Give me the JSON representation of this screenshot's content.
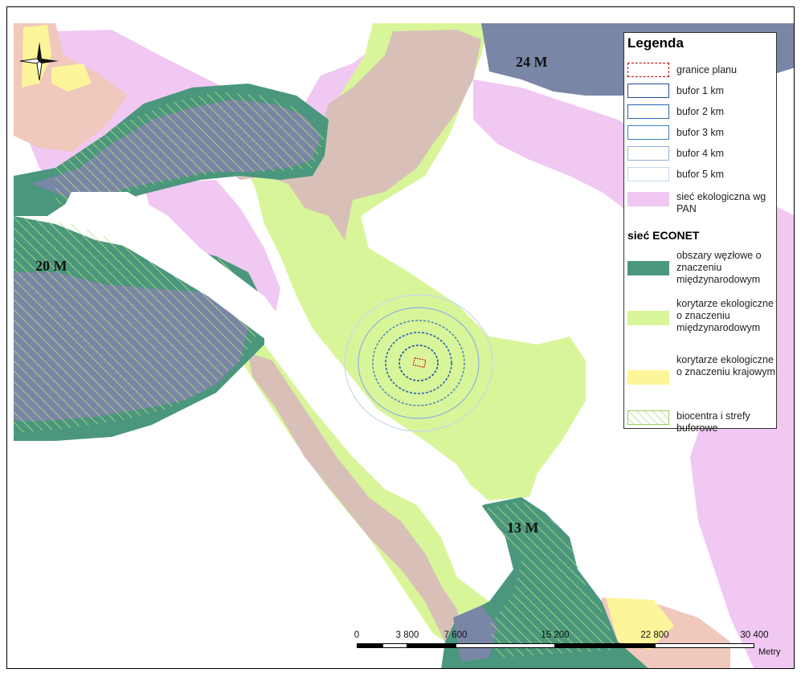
{
  "colors": {
    "node_international": "#4a977d",
    "corridor_international": "#d9f59a",
    "corridor_national": "#fdf59a",
    "pan_network": "#f0c8f2",
    "biocentre_hatch": "#b8e07a",
    "overlap_blue": "#7a86a6",
    "mauve": "#d8c0b8",
    "salmon": "#f0c8bc",
    "plan_border": "#c00000",
    "buffer_1km": "#1f4ea1",
    "buffer_2km": "#2a63b3",
    "buffer_3km": "#3f7ec4",
    "buffer_4km": "#8fb2df",
    "buffer_5km": "#c7d8ec"
  },
  "map": {
    "zone_labels": [
      {
        "text": "24 M"
      },
      {
        "text": "20 M"
      },
      {
        "text": "13 M"
      }
    ],
    "north_arrow_icon": "compass-rose-icon"
  },
  "legend": {
    "title": "Legenda",
    "items": [
      {
        "key": "plan",
        "label": "granice planu"
      },
      {
        "key": "b1",
        "label": "bufor 1 km"
      },
      {
        "key": "b2",
        "label": "bufor 2 km"
      },
      {
        "key": "b3",
        "label": "bufor 3 km"
      },
      {
        "key": "b4",
        "label": "bufor 4 km"
      },
      {
        "key": "b5",
        "label": "bufor 5 km"
      },
      {
        "key": "pan",
        "label": "sieć ekologiczna wg PAN"
      }
    ],
    "econet_title": "sieć ECONET",
    "econet_items": [
      {
        "key": "node",
        "label": "obszary węzłowe o znaczeniu międzynarodowym"
      },
      {
        "key": "corr_int",
        "label": "korytarze ekologiczne o znaczeniu międzynarodowym"
      },
      {
        "key": "corr_nat",
        "label": "korytarze ekologiczne o znaczeniu krajowym"
      },
      {
        "key": "bio",
        "label": "biocentra i strefy buforowe"
      }
    ]
  },
  "scalebar": {
    "ticks": [
      "0",
      "3 800",
      "7 600",
      "15 200",
      "22 800",
      "30 400"
    ],
    "unit": "Metry"
  }
}
